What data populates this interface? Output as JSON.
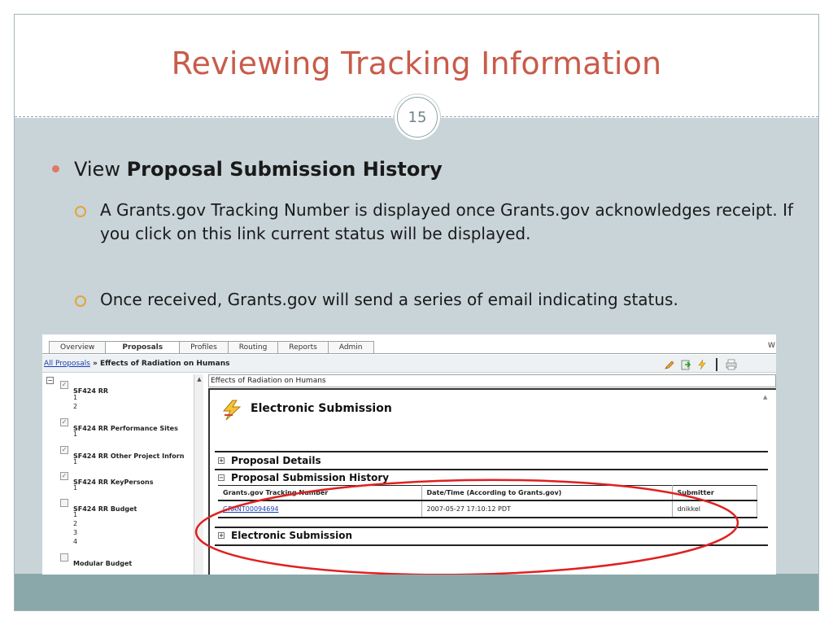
{
  "slide": {
    "title": "Reviewing Tracking Information",
    "page_number": "15",
    "bullet": {
      "prefix": "View ",
      "bold": "Proposal Submission History"
    },
    "sub_bullets": [
      "A Grants.gov Tracking Number is displayed once Grants.gov acknowledges receipt.  If you click on this link current status will be displayed.",
      "Once received, Grants.gov will send a series of email indicating status."
    ],
    "colors": {
      "title": "#c85c4a",
      "body_bg": "#c8d4d8",
      "footer_bg": "#8aa8aa",
      "annotation": "#e02020"
    }
  },
  "app": {
    "tabs": [
      "Overview",
      "Proposals",
      "Profiles",
      "Routing",
      "Reports",
      "Admin"
    ],
    "active_tab": "Proposals",
    "tab_right_text": "W",
    "breadcrumb": {
      "link": "All Proposals",
      "separator": " » ",
      "current": "Effects of Radiation on Humans"
    },
    "toolbar_icons": [
      "pencil-icon",
      "export-icon",
      "lightning-icon",
      "print-icon"
    ],
    "tree": {
      "items": [
        {
          "label": "SF424 RR",
          "checked": true,
          "children": [
            "1",
            "2"
          ]
        },
        {
          "label": "SF424 RR Performance Sites",
          "checked": true,
          "children": [
            "1"
          ]
        },
        {
          "label": "SF424 RR Other Project Inforn",
          "checked": true,
          "children": [
            "1"
          ]
        },
        {
          "label": "SF424 RR KeyPersons",
          "checked": true,
          "children": [
            "1"
          ]
        },
        {
          "label": "SF424 RR Budget",
          "checked": false,
          "children": [
            "1",
            "2",
            "3",
            "4"
          ]
        },
        {
          "label": "Modular Budget",
          "checked": false,
          "children": []
        }
      ]
    },
    "main": {
      "header": "Effects of Radiation on Humans",
      "page_title": "Electronic Submission",
      "sections": [
        "Proposal Details",
        "Proposal Submission History",
        "Electronic Submission"
      ],
      "history_table": {
        "columns": [
          "Grants.gov Tracking Number",
          "Date/Time (According to Grants.gov)",
          "Submitter"
        ],
        "rows": [
          {
            "tracking_number": "GRANT00094694",
            "datetime": "2007-05-27 17:10:12 PDT",
            "submitter": "dnikkel"
          }
        ]
      }
    }
  }
}
